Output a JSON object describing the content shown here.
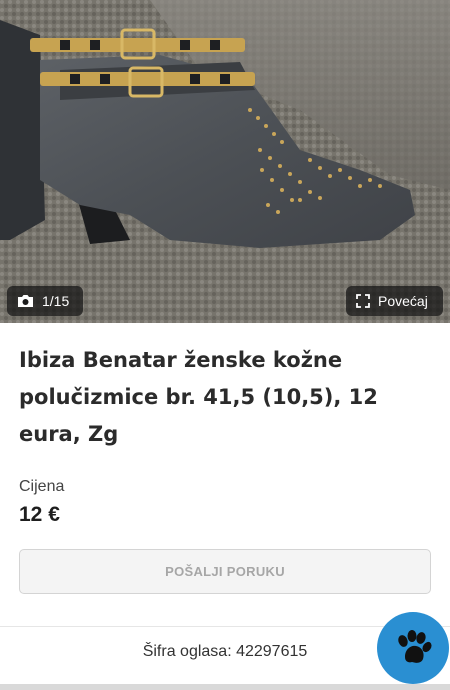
{
  "gallery": {
    "counter": "1/15",
    "zoom_label": "Povećaj"
  },
  "listing": {
    "title": "Ibiza Benatar ženske kožne polučizmice br. 41,5 (10,5), 12 eura, Zg",
    "price_label": "Cijena",
    "price_value": "12 €",
    "message_button": "POŠALJI PORUKU",
    "ad_code": "Šifra oglasa: 42297615"
  },
  "colors": {
    "accent": "#2a8fd2",
    "button_bg": "#f4f4f4",
    "button_text": "#a6a6a6"
  },
  "icons": {
    "counter": "camera-icon",
    "zoom": "expand-icon",
    "assistant": "paw-icon"
  }
}
